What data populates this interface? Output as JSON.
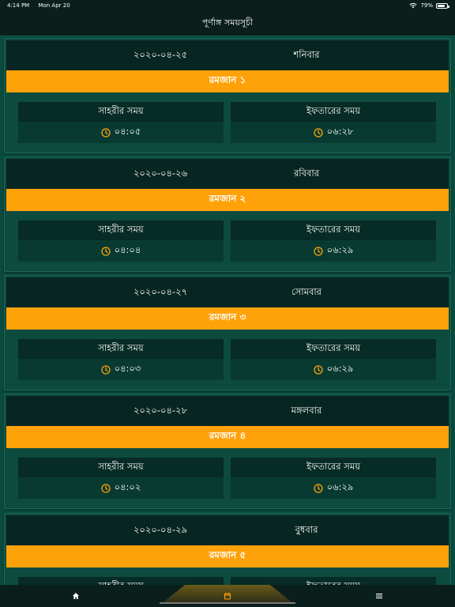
{
  "status_bar": {
    "time": "4:14 PM",
    "date": "Mon Apr 20",
    "battery_text": "79%",
    "battery_level": 0.79
  },
  "nav": {
    "title": "পূর্ণাঙ্গ সময়সূচী"
  },
  "labels": {
    "sehri": "সাহরীর সময়",
    "iftar": "ইফতারের সময়"
  },
  "days": [
    {
      "date": "২০২০-০৪-২৫",
      "weekday": "শনিবার",
      "ramadan": "রমজান ১",
      "sehri_time": "০৪:০৫",
      "iftar_time": "০৬:২৮"
    },
    {
      "date": "২০২০-০৪-২৬",
      "weekday": "রবিবার",
      "ramadan": "রমজান ২",
      "sehri_time": "০৪:০৪",
      "iftar_time": "০৬:২৯"
    },
    {
      "date": "২০২০-০৪-২৭",
      "weekday": "সোমবার",
      "ramadan": "রমজান ৩",
      "sehri_time": "০৪:০৩",
      "iftar_time": "০৬:২৯"
    },
    {
      "date": "২০২০-০৪-২৮",
      "weekday": "মঙ্গলবার",
      "ramadan": "রমজান ৪",
      "sehri_time": "০৪:০২",
      "iftar_time": "০৬:২৯"
    },
    {
      "date": "২০২০-০৪-২৯",
      "weekday": "বুধবার",
      "ramadan": "রমজান ৫",
      "sehri_time": "",
      "iftar_time": ""
    }
  ],
  "tabs": [
    {
      "icon": "home-icon",
      "active": false
    },
    {
      "icon": "calendar-icon",
      "active": true
    },
    {
      "icon": "menu-icon",
      "active": false
    }
  ],
  "colors": {
    "background": "#0b4a3e",
    "header": "#0a1f1c",
    "accent": "#ffa20a"
  }
}
